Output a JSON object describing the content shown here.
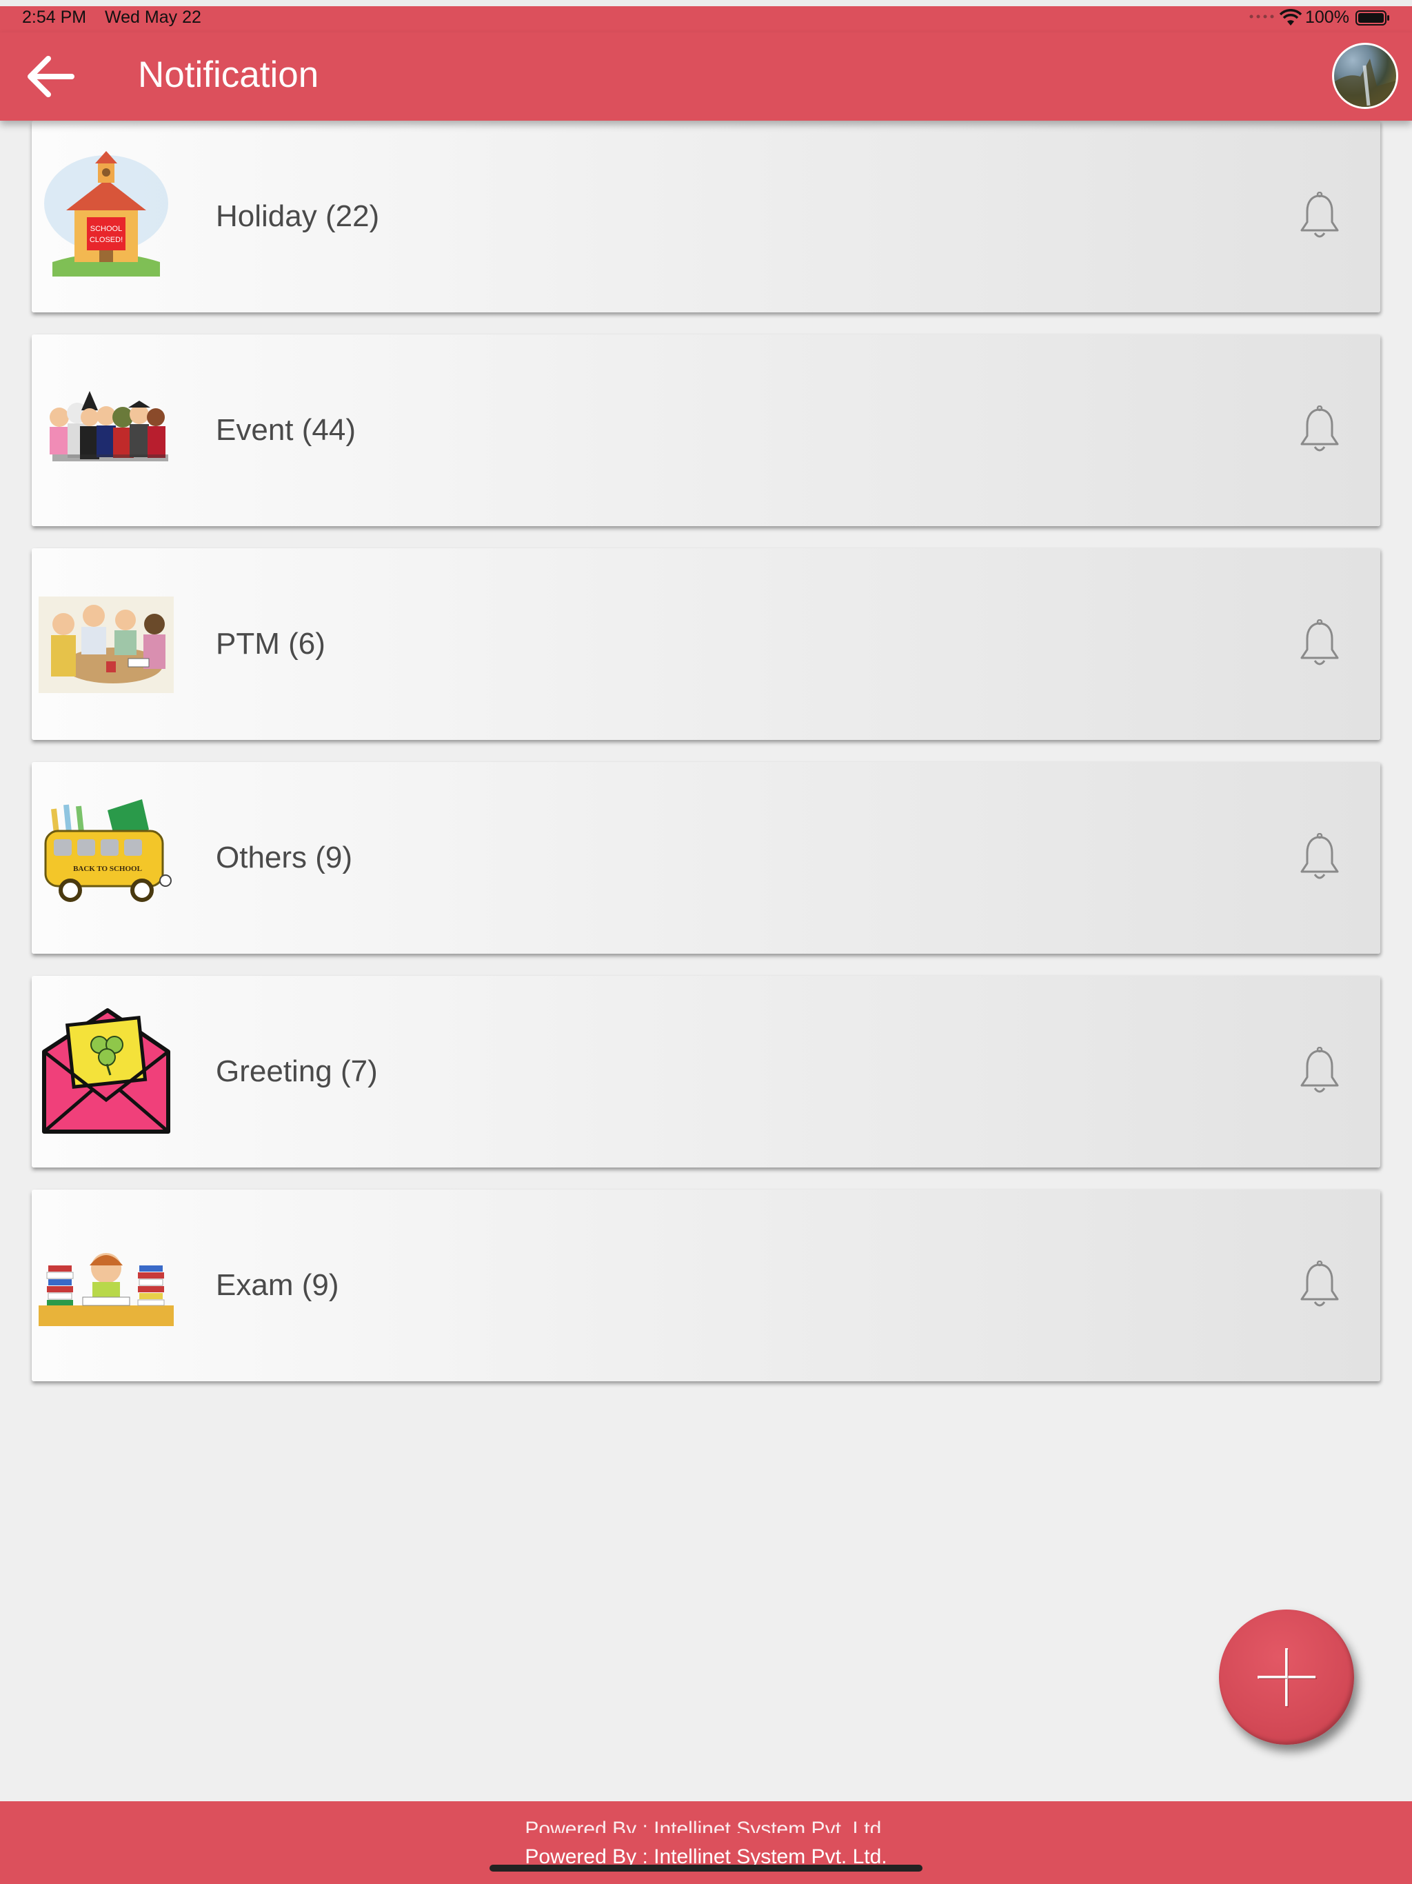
{
  "status_bar": {
    "time": "2:54 PM",
    "date": "Wed May 22",
    "battery": "100%",
    "battery_level": 1.0
  },
  "header": {
    "title": "Notification",
    "back_icon": "arrow-left-icon",
    "avatar_icon": "profile-avatar"
  },
  "categories": [
    {
      "label": "Holiday (22)",
      "icon": "school-closed-image"
    },
    {
      "label": "Event (44)",
      "icon": "costumed-kids-image"
    },
    {
      "label": "PTM (6)",
      "icon": "parent-teacher-meeting-image"
    },
    {
      "label": "Others (9)",
      "icon": "back-to-school-bus-image"
    },
    {
      "label": "Greeting (7)",
      "icon": "greeting-envelope-image"
    },
    {
      "label": "Exam (9)",
      "icon": "exam-study-image"
    }
  ],
  "fab": {
    "icon": "plus-icon"
  },
  "footer": {
    "credit": "Powered By : Intellinet System Pvt. Ltd.",
    "credit_ghost": "Powered By : Intellinet System Pvt. Ltd."
  },
  "colors": {
    "primary": "#dc505c",
    "background": "#efefef",
    "text": "#4a4a4a"
  }
}
